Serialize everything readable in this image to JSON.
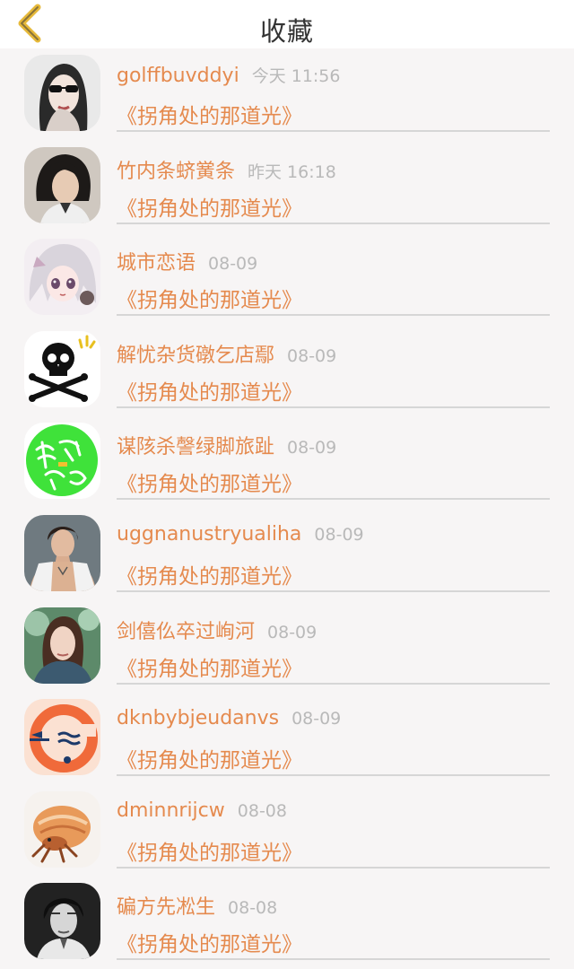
{
  "header": {
    "title": "收藏",
    "back_icon": "chevron-left-icon",
    "accent_color": "#e6b93a"
  },
  "colors": {
    "name": "#e58a4e",
    "time": "#b9b9b9",
    "background": "#f7f5f5"
  },
  "items": [
    {
      "name": "golffbuvddyi",
      "time": "今天 11:56",
      "book": "《拐角处的那道光》",
      "avatar": "woman-sunglasses-avatar"
    },
    {
      "name": "竹内条蛴黉条",
      "time": "昨天 16:18",
      "book": "《拐角处的那道光》",
      "avatar": "man-long-hair-avatar"
    },
    {
      "name": "城市恋语",
      "time": "08-09",
      "book": "《拐角处的那道光》",
      "avatar": "anime-girl-avatar"
    },
    {
      "name": "解忧杂货礅乞店鄢",
      "time": "08-09",
      "book": "《拐角处的那道光》",
      "avatar": "skull-crossbones-avatar"
    },
    {
      "name": "谋陔杀謦绿脚旅趾",
      "time": "08-09",
      "book": "《拐角处的那道光》",
      "avatar": "green-calligraphy-avatar"
    },
    {
      "name": "uggnanustryualiha",
      "time": "08-09",
      "book": "《拐角处的那道光》",
      "avatar": "shirtless-man-avatar"
    },
    {
      "name": "剑僖仫卒过峋河",
      "time": "08-09",
      "book": "《拐角处的那道光》",
      "avatar": "woman-forest-avatar"
    },
    {
      "name": "dknbybjeudanvs",
      "time": "08-09",
      "book": "《拐角处的那道光》",
      "avatar": "orange-logo-avatar"
    },
    {
      "name": "dminnrijcw",
      "time": "08-08",
      "book": "《拐角处的那道光》",
      "avatar": "hermit-crab-avatar"
    },
    {
      "name": "碥方先凇生",
      "time": "08-08",
      "book": "《拐角处的那道光》",
      "avatar": "man-bw-portrait-avatar"
    }
  ]
}
